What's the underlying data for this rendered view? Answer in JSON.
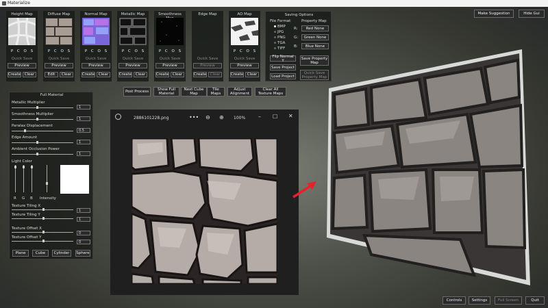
{
  "window": {
    "title": "Materialize"
  },
  "top_right": {
    "make_suggestion": "Make Suggestion",
    "hide_gui": "Hide Gui"
  },
  "maps": [
    {
      "title": "Height Map",
      "quick_save": "Quick Save",
      "preview": "Preview",
      "btn1": "Create",
      "btn2": "Clear",
      "disabled": false
    },
    {
      "title": "Diffuse Map",
      "quick_save": "Quick Save",
      "preview": "Preview",
      "btn1": "Edit",
      "btn2": "Clear",
      "disabled": false
    },
    {
      "title": "Normal Map",
      "quick_save": "Quick Save",
      "preview": "Preview",
      "btn1": "Create",
      "btn2": "Clear",
      "disabled": false
    },
    {
      "title": "Metallic Map",
      "quick_save": "Quick Save",
      "preview": "Preview",
      "btn1": "Create",
      "btn2": "Clear",
      "disabled": false
    },
    {
      "title": "Smoothness Map",
      "quick_save": "Quick Save",
      "preview": "Preview",
      "btn1": "Create",
      "btn2": "Clear",
      "disabled": false
    },
    {
      "title": "Edge Map",
      "quick_save": "Quick Save",
      "preview": "Preview",
      "btn1": "Create",
      "btn2": "Clear",
      "disabled": true
    },
    {
      "title": "AO Map",
      "quick_save": "Quick Save",
      "preview": "Preview",
      "btn1": "Create",
      "btn2": "Clear",
      "disabled": false
    }
  ],
  "pcos": [
    "P",
    "C",
    "O",
    "S"
  ],
  "saving": {
    "title": "Saving Options",
    "file_format": "File Format",
    "formats": [
      "BMP",
      "JPG",
      "PNG",
      "TGA",
      "TIFF"
    ],
    "selected_format": "BMP",
    "property_map": "Property Map",
    "channels": [
      {
        "letter": "R:",
        "value": "Red None"
      },
      {
        "letter": "G:",
        "value": "Green None"
      },
      {
        "letter": "B:",
        "value": "Blue None"
      }
    ],
    "flip_normal": "Flip Normal Y",
    "save_property": "Save Property Map",
    "save_project": "Save Project",
    "load_project": "Load Project",
    "quick_save_property": "Quick Save Property Map"
  },
  "toolbar2": [
    "Post Process",
    "Show Full Material",
    "Next Cube Map",
    "Tile Maps",
    "Adjust Alignment",
    "Clear All Texture Maps"
  ],
  "full_material": {
    "title": "Full Material",
    "sliders": [
      {
        "label": "Metallic Multiplier",
        "value": "1"
      },
      {
        "label": "Smoothness Multiplier",
        "value": "1"
      },
      {
        "label": "Paralax Displacement",
        "value": "0.5"
      },
      {
        "label": "Edge Amount",
        "value": "1"
      },
      {
        "label": "Ambient Occlusion Power",
        "value": "1"
      }
    ],
    "light_color": "Light Color",
    "rgb": [
      "R",
      "G",
      "B"
    ],
    "intensity": "Intensity",
    "tiling": [
      {
        "label": "Texture Tiling X",
        "value": "1"
      },
      {
        "label": "Texture Tiling Y",
        "value": "1"
      },
      {
        "label": "Texture Offset X",
        "value": "0"
      },
      {
        "label": "Texture Offset Y",
        "value": "0"
      }
    ],
    "shapes": [
      "Plane",
      "Cube",
      "Cylinder",
      "Sphere"
    ]
  },
  "viewer": {
    "filename": "2886101228.png",
    "zoom": "100%",
    "more": "•••"
  },
  "bottom": {
    "controls": "Controls",
    "settings": "Settings",
    "full_screen": "Full Screen",
    "quit": "Quit"
  },
  "colors": {
    "arrow": "#e8202a",
    "light_swatch": "#ffffff"
  }
}
